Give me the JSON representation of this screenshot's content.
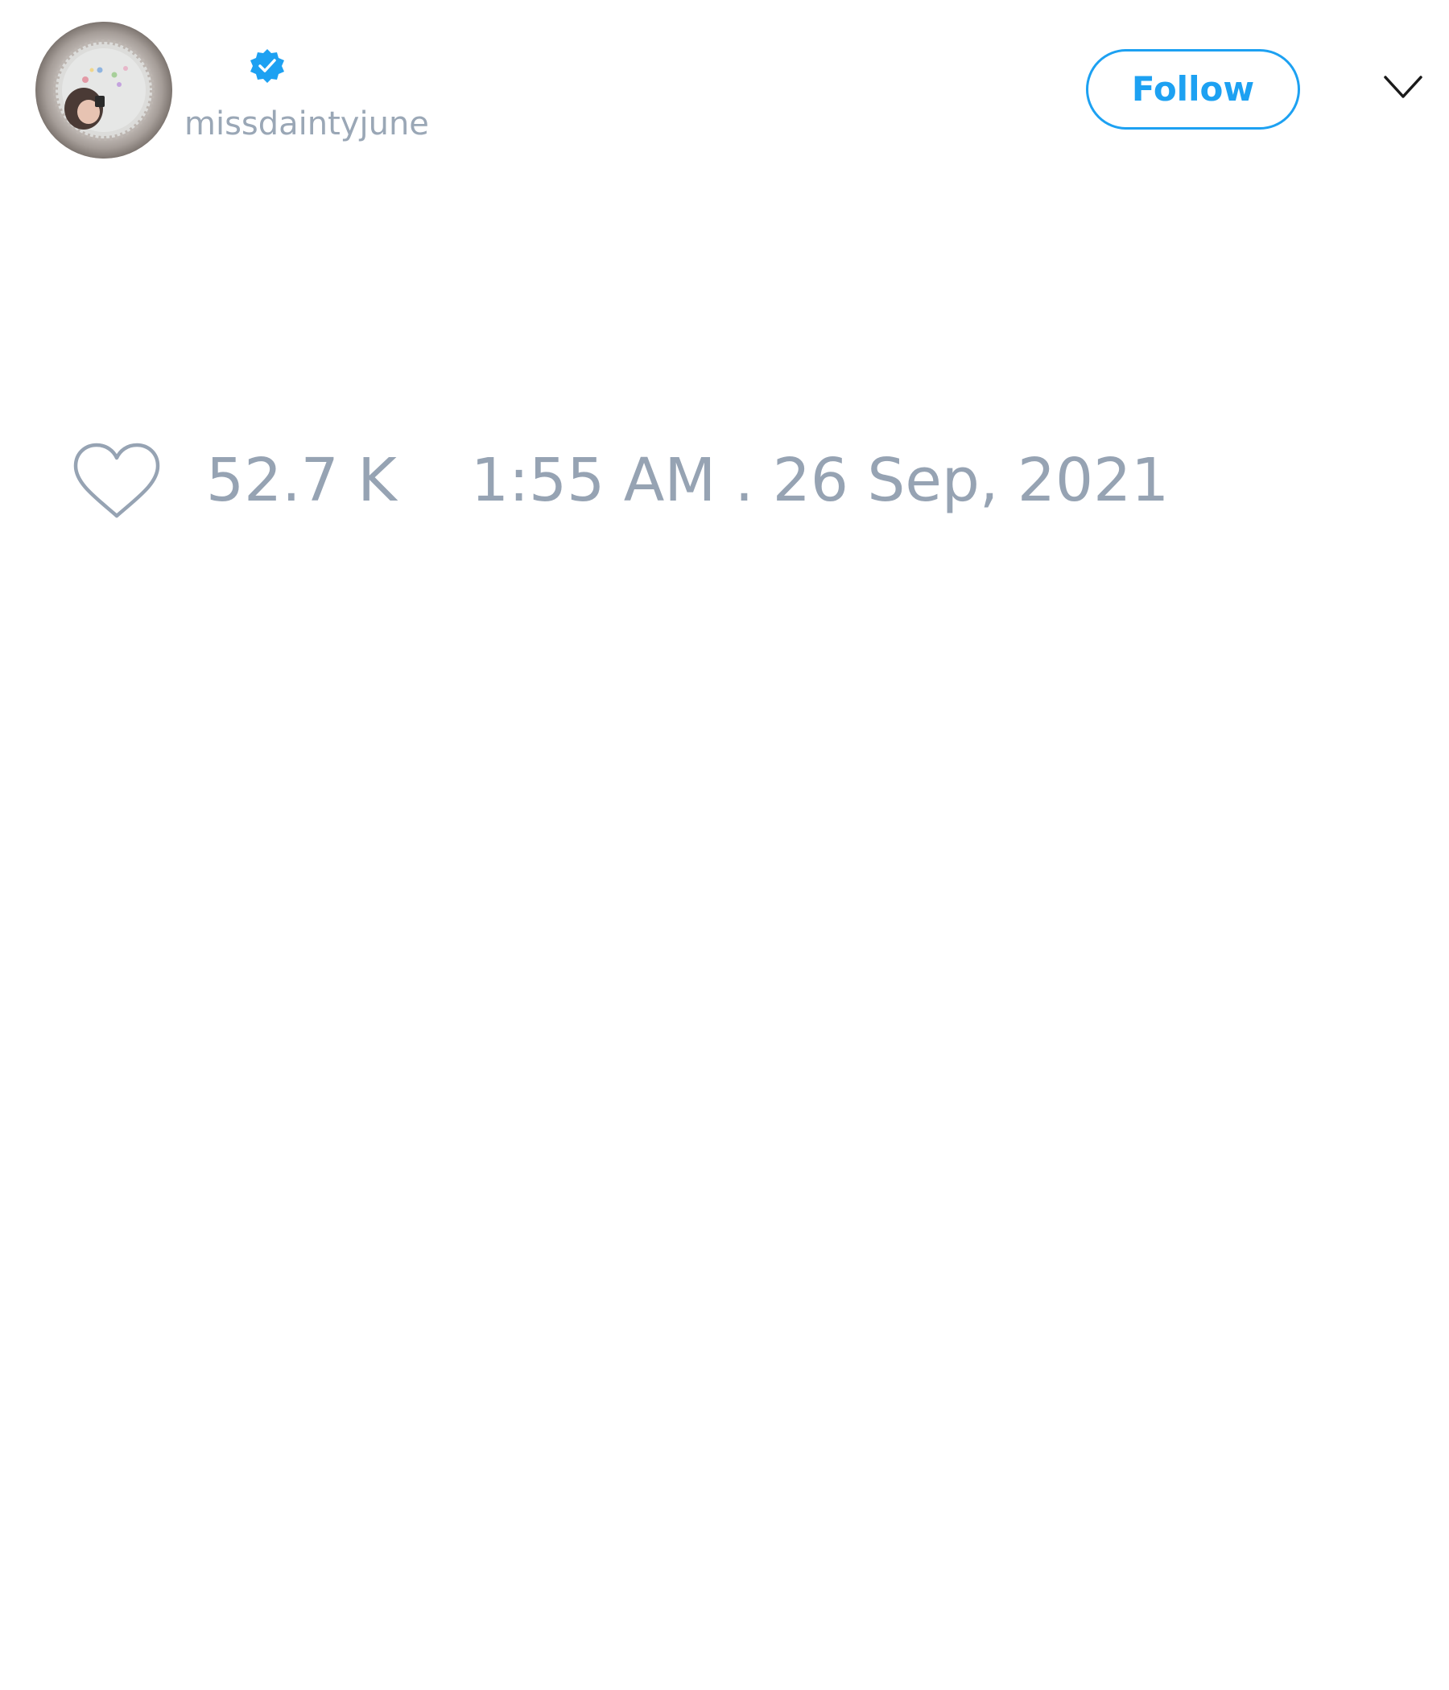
{
  "author": {
    "display_name": "",
    "username": "missdaintyjune",
    "verified": true,
    "avatar_icon": "profile-photo"
  },
  "header": {
    "follow_label": "Follow",
    "menu_icon": "chevron-down-icon"
  },
  "stats": {
    "likes": "52.7 K",
    "timestamp": "1:55 AM . 26 Sep, 2021",
    "like_icon": "heart-outline-icon"
  },
  "colors": {
    "accent": "#1da1f2",
    "muted_text": "#96a3b3",
    "background": "#ffffff",
    "verified": "#1da1f2"
  }
}
